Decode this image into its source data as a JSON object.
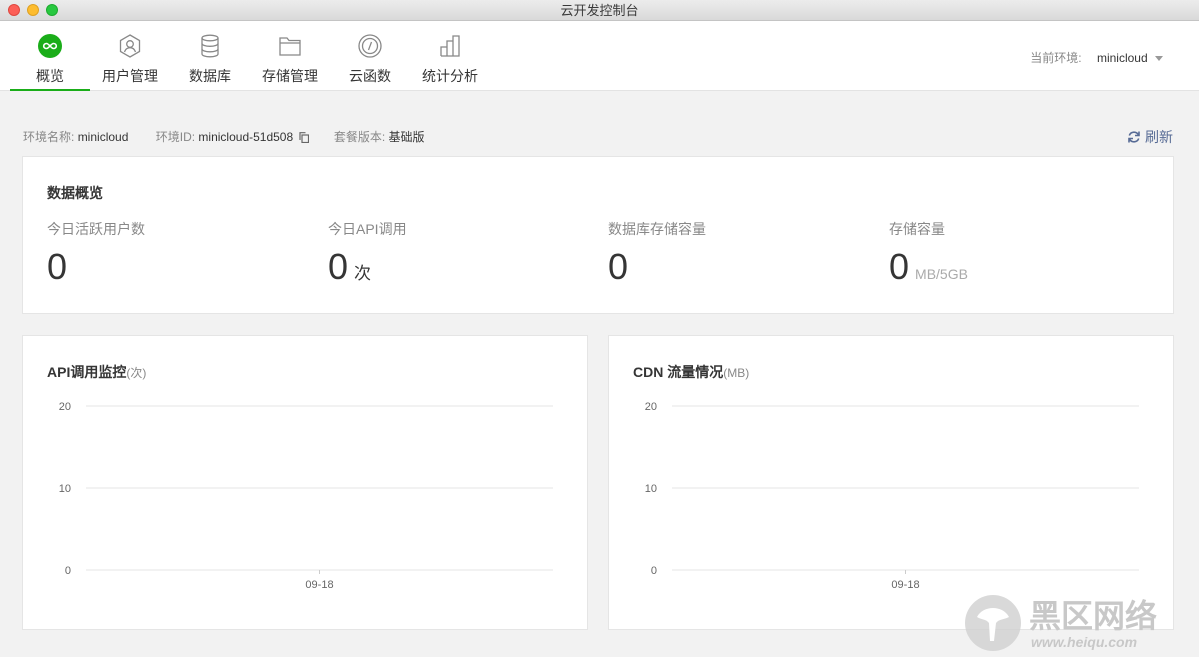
{
  "window": {
    "title": "云开发控制台"
  },
  "nav": {
    "items": [
      {
        "label": "概览",
        "icon": "infinity-icon",
        "active": true
      },
      {
        "label": "用户管理",
        "icon": "user-icon",
        "active": false
      },
      {
        "label": "数据库",
        "icon": "database-icon",
        "active": false
      },
      {
        "label": "存储管理",
        "icon": "folder-icon",
        "active": false
      },
      {
        "label": "云函数",
        "icon": "function-icon",
        "active": false
      },
      {
        "label": "统计分析",
        "icon": "bar-chart-icon",
        "active": false
      }
    ],
    "env_label": "当前环境:",
    "env_value": "minicloud"
  },
  "info": {
    "env_name_label": "环境名称:",
    "env_name": "minicloud",
    "env_id_label": "环境ID:",
    "env_id": "minicloud-51d508",
    "plan_label": "套餐版本:",
    "plan": "基础版",
    "refresh_label": "刷新"
  },
  "overview": {
    "title": "数据概览",
    "metrics": [
      {
        "label": "今日活跃用户数",
        "value": "0",
        "unit": ""
      },
      {
        "label": "今日API调用",
        "value": "0",
        "unit": "次"
      },
      {
        "label": "数据库存储容量",
        "value": "0",
        "unit": ""
      },
      {
        "label": "存储容量",
        "value": "0",
        "unit": "MB/5GB"
      }
    ]
  },
  "charts": {
    "api": {
      "title": "API调用监控",
      "unit": "(次)"
    },
    "cdn": {
      "title": "CDN 流量情况",
      "unit": "(MB)"
    }
  },
  "chart_data": [
    {
      "type": "line",
      "title": "API调用监控(次)",
      "categories": [
        "09-18"
      ],
      "series": [
        {
          "values": [
            0
          ]
        }
      ],
      "ylim": [
        0,
        20
      ],
      "yticks": [
        "20",
        "10",
        "0"
      ],
      "grid": true
    },
    {
      "type": "line",
      "title": "CDN 流量情况(MB)",
      "categories": [
        "09-18"
      ],
      "series": [
        {
          "values": [
            0
          ]
        }
      ],
      "ylim": [
        0,
        20
      ],
      "yticks": [
        "20",
        "10",
        "0"
      ],
      "grid": true
    }
  ],
  "watermark": {
    "text": "黑区网络",
    "url_text": "www.heiqu.com"
  },
  "colors": {
    "accent": "#1aad19",
    "link": "#576b95"
  }
}
